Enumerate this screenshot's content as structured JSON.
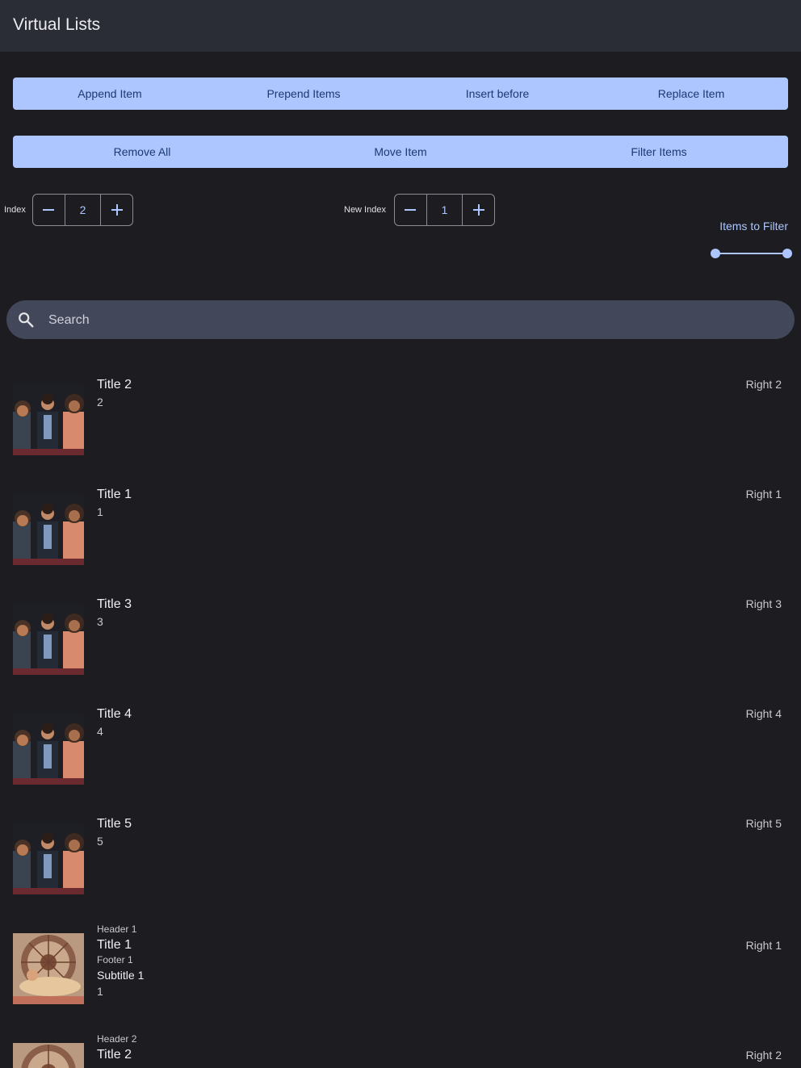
{
  "appbar": {
    "title": "Virtual Lists"
  },
  "toolbar1": [
    {
      "label": "Append Item"
    },
    {
      "label": "Prepend Items"
    },
    {
      "label": "Insert before"
    },
    {
      "label": "Replace Item"
    }
  ],
  "toolbar2": [
    {
      "label": "Remove All"
    },
    {
      "label": "Move Item"
    },
    {
      "label": "Filter Items"
    }
  ],
  "index_stepper": {
    "label": "Index",
    "value": "2"
  },
  "new_index_stepper": {
    "label": "New Index",
    "value": "1"
  },
  "filter": {
    "label": "Items to Filter",
    "range": [
      0,
      1
    ]
  },
  "search": {
    "placeholder": "Search",
    "icon": "search-icon"
  },
  "colors": {
    "accent": "#adc6ff",
    "background": "#1c1c21",
    "appbar": "#2a2d36",
    "search_bg": "#43475a"
  },
  "list": [
    {
      "title": "Title 2",
      "sub": "2",
      "right": "Right 2"
    },
    {
      "title": "Title 1",
      "sub": "1",
      "right": "Right 1"
    },
    {
      "title": "Title 3",
      "sub": "3",
      "right": "Right 3"
    },
    {
      "title": "Title 4",
      "sub": "4",
      "right": "Right 4"
    },
    {
      "title": "Title 5",
      "sub": "5",
      "right": "Right 5"
    }
  ],
  "list2": [
    {
      "header": "Header 1",
      "title": "Title 1",
      "footer": "Footer 1",
      "subtitle": "Subtitle 1",
      "sub": "1",
      "right": "Right 1"
    },
    {
      "header": "Header 2",
      "title": "Title 2",
      "right": "Right 2"
    }
  ]
}
